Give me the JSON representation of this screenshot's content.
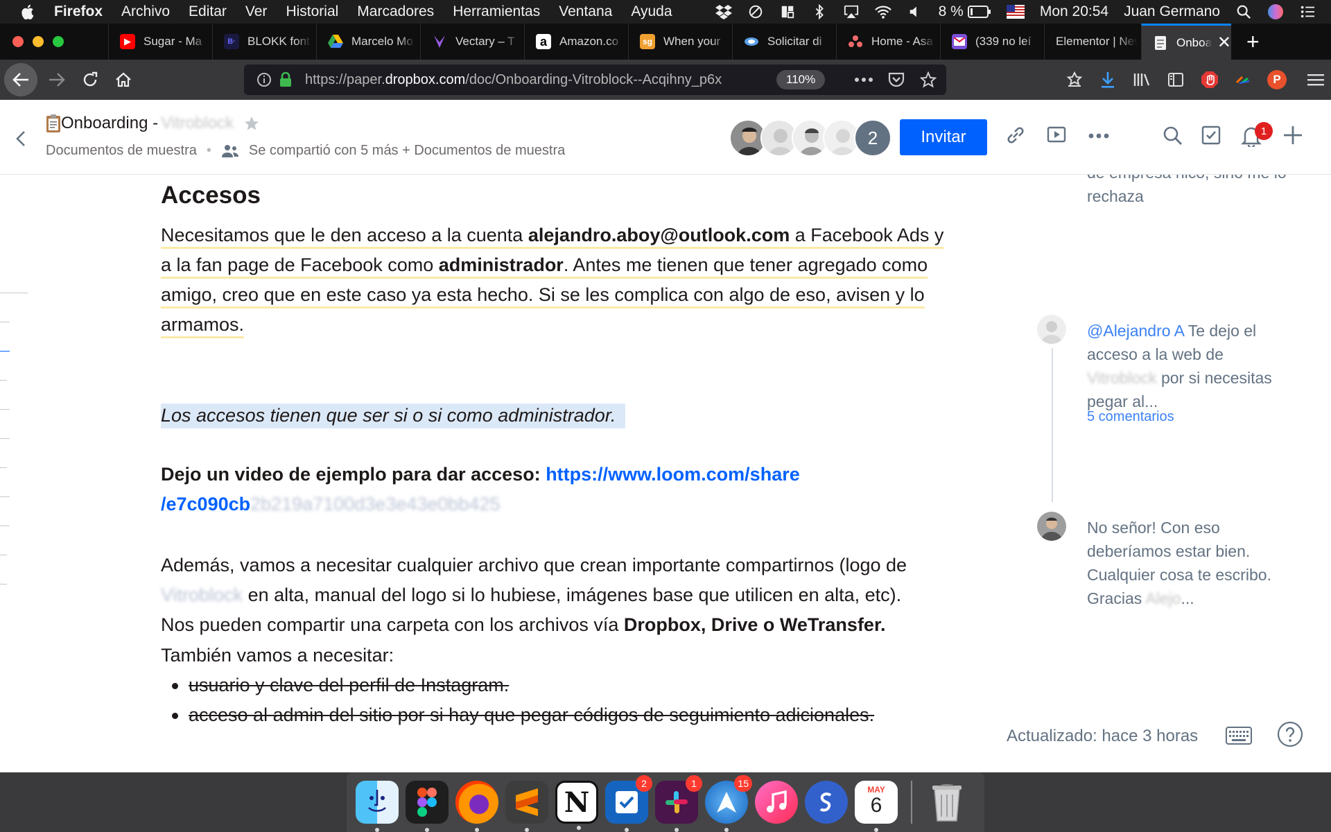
{
  "menubar": {
    "app_name": "Firefox",
    "menus": [
      "Archivo",
      "Editar",
      "Ver",
      "Historial",
      "Marcadores",
      "Herramientas",
      "Ventana",
      "Ayuda"
    ],
    "battery": "8 %",
    "clock": "Mon 20:54",
    "user": "Juan Germano"
  },
  "tabs": [
    {
      "title": "Sugar - Ma",
      "icon": "youtube-icon"
    },
    {
      "title": "BLOKK font",
      "icon": "blokk-icon"
    },
    {
      "title": "Marcelo Mo",
      "icon": "google-drive-icon"
    },
    {
      "title": "Vectary – T",
      "icon": "vectary-icon"
    },
    {
      "title": "Amazon.co",
      "icon": "amazon-icon"
    },
    {
      "title": "When your",
      "icon": "sg-icon"
    },
    {
      "title": "Solicitar di",
      "icon": "solicitar-icon"
    },
    {
      "title": "Home - Asa",
      "icon": "asana-icon"
    },
    {
      "title": "(339 no leí",
      "icon": "mail-icon"
    },
    {
      "title": "Elementor | New",
      "icon": ""
    },
    {
      "title": "Onboard",
      "icon": "paper-doc-icon",
      "active": true
    }
  ],
  "navbar": {
    "url_prefix": "https://paper.",
    "url_domain": "dropbox.com",
    "url_path": "/doc/Onboarding-Vitroblock--Acqihny_p6x",
    "zoom": "110%",
    "profile_initial": "P"
  },
  "doc_header": {
    "title": "Onboarding -",
    "title_hidden": "Vitroblock",
    "folder": "Documentos de muestra",
    "shared_text": "Se compartió con 5 más + Documentos de muestra",
    "extra_count": "2",
    "invite_label": "Invitar",
    "notification_count": "1"
  },
  "doc": {
    "heading": "Accesos",
    "p1_a": "Necesitamos que le den acceso a la cuenta ",
    "p1_email": "alejandro.aboy@outlook.com",
    "p1_b": " a Facebook Ads y",
    "p1_c": "a la fan page de Facebook como ",
    "p1_admin": "administrador",
    "p1_d": ". Antes me tienen que tener agregado como",
    "p1_e": "amigo, creo que en este caso ya esta hecho. Si se les complica con algo de eso, avisen y lo",
    "p1_f": "armamos.",
    "p2": "Los accesos tienen que ser si o si como administrador.",
    "p3_label": "Dejo un video de ejemplo para dar acceso: ",
    "p3_link_1": "https://www.loom.com/share",
    "p3_link_2": "/e7c090cb",
    "p3_link_hidden": "2b219a7100d3e3e43e0bb425",
    "p4_a": "Además, vamos a necesitar cualquier archivo que crean importante compartirnos (logo de",
    "p4_hidden": "Vitroblock",
    "p4_b": " en alta, manual del logo si lo hubiese, imágenes base que utilicen en alta, etc).",
    "p4_c": "Nos pueden compartir una carpeta con los archivos vía ",
    "p4_bold": "Dropbox, Drive o WeTransfer.",
    "p5": "También vamos a necesitar:",
    "bullets": [
      "usuario y clave del perfil de Instagram.",
      "acceso al admin del sitio por si hay que pegar códigos de seguimiento adicionales."
    ]
  },
  "comments": {
    "c0_tail_1": "de empresa nico, sino me lo",
    "c0_tail_2": "rechaza",
    "c1_mention": "@Alejandro A",
    "c1_a": "  Te dejo el",
    "c1_b": "acceso a la web de",
    "c1_hidden": "Vitroblock",
    "c1_c": " por si necesitas",
    "c1_d": "pegar al...",
    "more": "5 comentarios",
    "c2_a": "No señor! Con eso",
    "c2_b": "deberíamos estar bien.",
    "c2_c": "Cualquier cosa te escribo.",
    "c2_d": "Gracias",
    "c2_hidden": "Alejo",
    "c2_e": "..."
  },
  "footer": {
    "updated": "Actualizado: hace 3 horas"
  },
  "dock": {
    "apps": [
      {
        "name": "finder-icon",
        "running": true
      },
      {
        "name": "figma-icon",
        "running": true
      },
      {
        "name": "firefox-icon",
        "running": true
      },
      {
        "name": "sublime-text-icon",
        "running": true
      },
      {
        "name": "notion-icon",
        "running": true
      },
      {
        "name": "tasks-icon",
        "badge": "2",
        "running": true
      },
      {
        "name": "slack-icon",
        "badge": "1",
        "running": true
      },
      {
        "name": "spark-icon",
        "badge": "15",
        "running": true
      },
      {
        "name": "music-icon",
        "running": false
      },
      {
        "name": "simplenote-icon",
        "running": false
      },
      {
        "name": "calendar-icon",
        "running": true
      }
    ],
    "calendar_month": "MAY",
    "calendar_day": "6"
  },
  "colors": {
    "accent": "#0061fe",
    "highlight": "#dbe8f7",
    "underline": "#fbe9a7",
    "badge": "#e02020"
  }
}
